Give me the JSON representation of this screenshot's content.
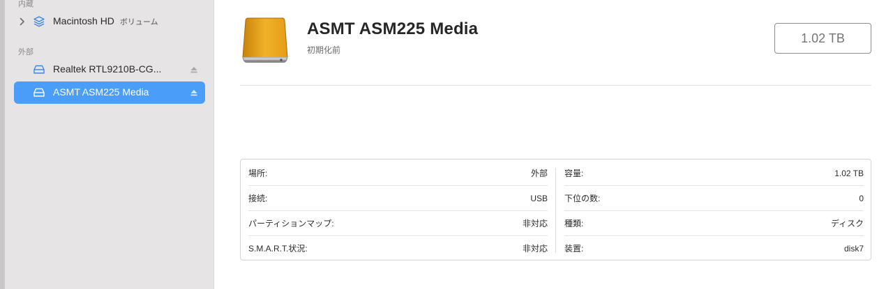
{
  "sidebar": {
    "section_internal": "内蔵",
    "section_external": "外部",
    "items": [
      {
        "label": "Macintosh HD",
        "sub": "ボリューム"
      },
      {
        "label": "Realtek RTL9210B-CG..."
      },
      {
        "label": "ASMT ASM225 Media"
      }
    ]
  },
  "main": {
    "title": "ASMT ASM225 Media",
    "subtitle": "初期化前",
    "capacity": "1.02 TB"
  },
  "info": {
    "left": [
      {
        "label": "場所:",
        "value": "外部"
      },
      {
        "label": "接続:",
        "value": "USB"
      },
      {
        "label": "パーティションマップ:",
        "value": "非対応"
      },
      {
        "label": "S.M.A.R.T.状況:",
        "value": "非対応"
      }
    ],
    "right": [
      {
        "label": "容量:",
        "value": "1.02 TB"
      },
      {
        "label": "下位の数:",
        "value": "0"
      },
      {
        "label": "種類:",
        "value": "ディスク"
      },
      {
        "label": "装置:",
        "value": "disk7"
      }
    ]
  },
  "colors": {
    "sidebar_bg": "#e6e4e5",
    "selection": "#4a9df8",
    "icon_blue": "#3a86e8",
    "drive_gold": "#e7a21a"
  }
}
